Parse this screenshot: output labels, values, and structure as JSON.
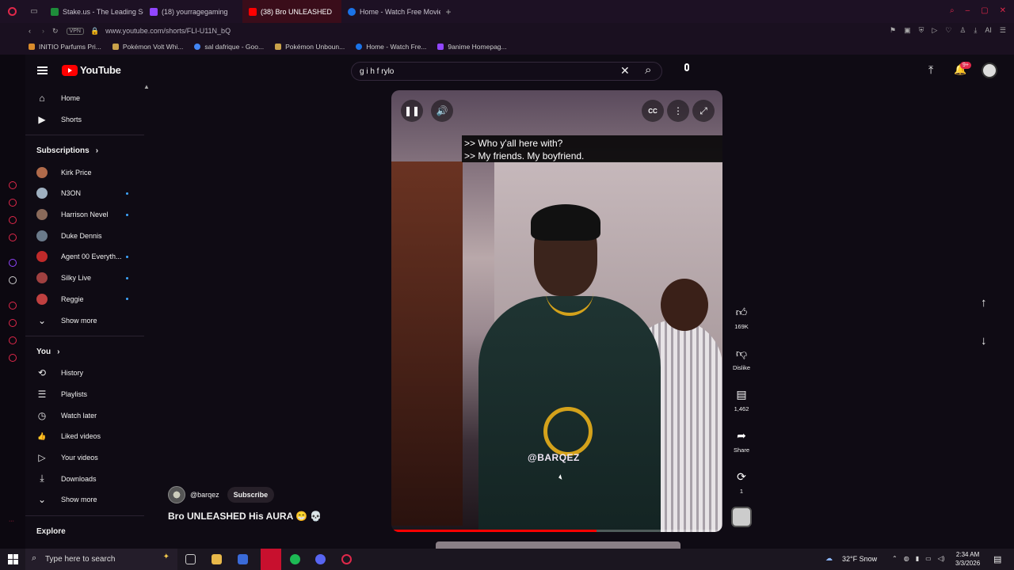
{
  "browser": {
    "tabs": [
      {
        "label": "Stake.us - The Leading Sc",
        "active": false,
        "favicon_color": "#1e8c3a"
      },
      {
        "label": "(18) yourragegaming",
        "active": false,
        "favicon_color": "#9146ff"
      },
      {
        "label": "(38) Bro UNLEASHED",
        "active": true,
        "favicon_color": "#ff0000"
      },
      {
        "label": "Home - Watch Free Movie",
        "active": false,
        "favicon_color": "#1a73e8"
      }
    ],
    "url": "www.youtube.com/shorts/FLI-U11N_bQ",
    "vpn_label": "VPN",
    "bookmarks": [
      {
        "label": "INITIO Parfums Pri...",
        "color": "#d98b2b"
      },
      {
        "label": "Pokémon Volt Whi...",
        "color": "#c9a24a"
      },
      {
        "label": "sal dafrique - Goo...",
        "color": "#4285f4"
      },
      {
        "label": "Pokémon Unboun...",
        "color": "#c9a24a"
      },
      {
        "label": "Home - Watch Fre...",
        "color": "#1a73e8"
      },
      {
        "label": "9anime Homepag...",
        "color": "#9146ff"
      }
    ],
    "new_tab": "+"
  },
  "youtube": {
    "logo_text": "YouTube",
    "search_value": "g i h f rylo",
    "notification_count": "9+",
    "sidebar": {
      "main": [
        {
          "label": "Home",
          "icon": "home-icon",
          "glyph": "⌂"
        },
        {
          "label": "Shorts",
          "icon": "shorts-icon",
          "glyph": "▶"
        }
      ],
      "subscriptions_title": "Subscriptions",
      "subscriptions": [
        {
          "label": "Kirk Price",
          "color": "#b06a4a",
          "live": false
        },
        {
          "label": "N3ON",
          "color": "#9fb0c0",
          "live": true
        },
        {
          "label": "Harrison Nevel",
          "color": "#8a6a5a",
          "live": true
        },
        {
          "label": "Duke Dennis",
          "color": "#6a7a8a",
          "live": false
        },
        {
          "label": "Agent 00 Everyth...",
          "color": "#c02a2a",
          "live": true
        },
        {
          "label": "Silky Live",
          "color": "#a04040",
          "live": true
        },
        {
          "label": "Reggie",
          "color": "#c04040",
          "live": true
        }
      ],
      "show_more_1": "Show more",
      "you_title": "You",
      "you_items": [
        {
          "label": "History",
          "glyph": "⟲"
        },
        {
          "label": "Playlists",
          "glyph": "☰"
        },
        {
          "label": "Watch later",
          "glyph": "◷"
        },
        {
          "label": "Liked videos",
          "glyph": "👍"
        },
        {
          "label": "Your videos",
          "glyph": "▷"
        },
        {
          "label": "Downloads",
          "glyph": "⤓"
        }
      ],
      "show_more_2": "Show more",
      "explore_title": "Explore"
    },
    "short": {
      "subtitle_line1": ">> Who y'all here with?",
      "subtitle_line2": ">> My friends. My boyfriend.",
      "watermark": "@BARQEZ",
      "channel": "@barqez",
      "subscribe_label": "Subscribe",
      "title": "Bro UNLEASHED His AURA 😁 💀",
      "progress": 0.62,
      "likes": "169K",
      "dislike_label": "Dislike",
      "comments": "1,462",
      "share_label": "Share",
      "remix_count": "1"
    }
  },
  "taskbar": {
    "search_placeholder": "Type here to search",
    "weather": "32°F  Snow",
    "time": "2:34 AM",
    "date": "3/3/2026"
  }
}
